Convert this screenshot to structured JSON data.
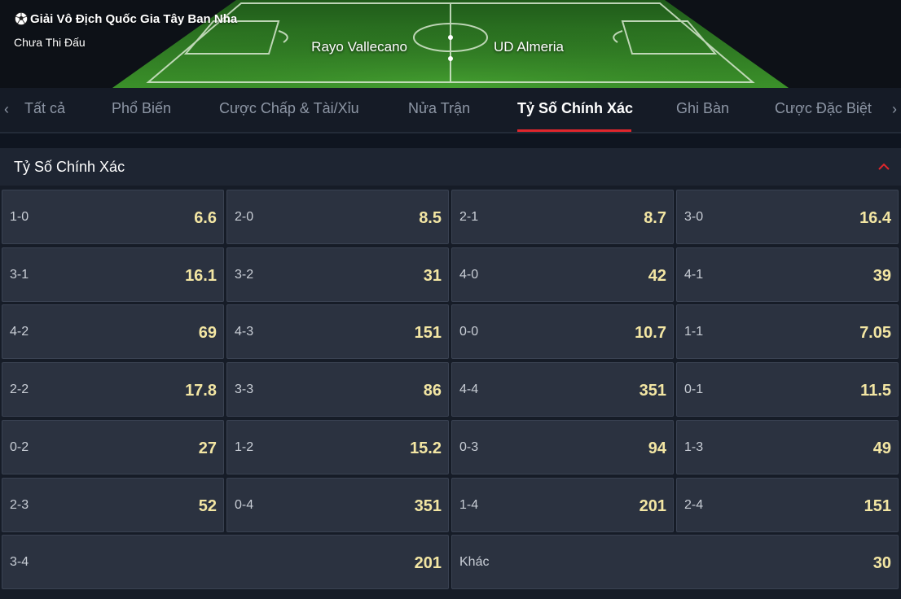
{
  "header": {
    "league": "Giải Vô Địch Quốc Gia Tây Ban Nha",
    "status": "Chưa Thi Đấu",
    "home_team": "Rayo Vallecano",
    "away_team": "UD Almeria"
  },
  "tabs": [
    {
      "label": "Tất cả"
    },
    {
      "label": "Phổ Biến"
    },
    {
      "label": "Cược Chấp & Tài/Xỉu"
    },
    {
      "label": "Nửa Trận"
    },
    {
      "label": "Tỷ Số Chính Xác",
      "active": true
    },
    {
      "label": "Ghi Bàn"
    },
    {
      "label": "Cược Đặc Biệt"
    }
  ],
  "section": {
    "title": "Tỷ Số Chính Xác"
  },
  "odds": [
    {
      "score": "1-0",
      "odd": "6.6"
    },
    {
      "score": "2-0",
      "odd": "8.5"
    },
    {
      "score": "2-1",
      "odd": "8.7"
    },
    {
      "score": "3-0",
      "odd": "16.4"
    },
    {
      "score": "3-1",
      "odd": "16.1"
    },
    {
      "score": "3-2",
      "odd": "31"
    },
    {
      "score": "4-0",
      "odd": "42"
    },
    {
      "score": "4-1",
      "odd": "39"
    },
    {
      "score": "4-2",
      "odd": "69"
    },
    {
      "score": "4-3",
      "odd": "151"
    },
    {
      "score": "0-0",
      "odd": "10.7"
    },
    {
      "score": "1-1",
      "odd": "7.05"
    },
    {
      "score": "2-2",
      "odd": "17.8"
    },
    {
      "score": "3-3",
      "odd": "86"
    },
    {
      "score": "4-4",
      "odd": "351"
    },
    {
      "score": "0-1",
      "odd": "11.5"
    },
    {
      "score": "0-2",
      "odd": "27"
    },
    {
      "score": "1-2",
      "odd": "15.2"
    },
    {
      "score": "0-3",
      "odd": "94"
    },
    {
      "score": "1-3",
      "odd": "49"
    },
    {
      "score": "2-3",
      "odd": "52"
    },
    {
      "score": "0-4",
      "odd": "351"
    },
    {
      "score": "1-4",
      "odd": "201"
    },
    {
      "score": "2-4",
      "odd": "151"
    },
    {
      "score": "3-4",
      "odd": "201"
    },
    {
      "score": "Khác",
      "odd": "30"
    }
  ],
  "colors": {
    "accent": "#e0262c",
    "odd_text": "#f3e6a3",
    "pitch_green": "#3f8f2a"
  }
}
